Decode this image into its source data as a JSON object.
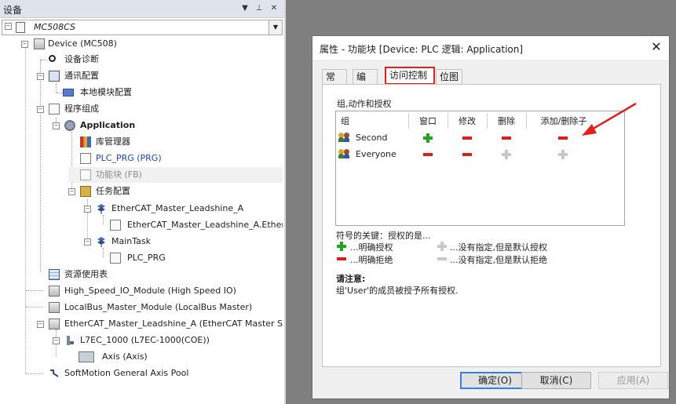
{
  "panel": {
    "title": "设备",
    "pin_glyph": "▼ ⊥ ✕",
    "project": "MC508CS",
    "tree": [
      {
        "label": "Device (MC508)"
      },
      {
        "label": "设备诊断"
      },
      {
        "label": "通讯配置"
      },
      {
        "label": "本地模块配置"
      },
      {
        "label": "程序组成"
      },
      {
        "label": "Application"
      },
      {
        "label": "库管理器"
      },
      {
        "label": "PLC_PRG (PRG)"
      },
      {
        "label": "功能块 (FB)"
      },
      {
        "label": "任务配置"
      },
      {
        "label": "EtherCAT_Master_Leadshine_A"
      },
      {
        "label": "EtherCAT_Master_Leadshine_A.EtherCAT_Task"
      },
      {
        "label": "MainTask"
      },
      {
        "label": "PLC_PRG"
      },
      {
        "label": "资源使用表"
      },
      {
        "label": "High_Speed_IO_Module (High Speed IO)"
      },
      {
        "label": "LocalBus_Master_Module (LocalBus Master)"
      },
      {
        "label": "EtherCAT_Master_Leadshine_A (EtherCAT Master SoftMotion)"
      },
      {
        "label": "L7EC_1000 (L7EC-1000(COE))"
      },
      {
        "label": "Axis (Axis)"
      },
      {
        "label": "SoftMotion General Axis Pool"
      }
    ]
  },
  "dialog": {
    "title": "属性 - 功能块 [Device: PLC 逻辑: Application]",
    "close": "✕",
    "tabs": [
      "常规",
      "编译",
      "访问控制",
      "位图"
    ],
    "active_tab": "访问控制",
    "group_label": "组,动作和授权",
    "columns": [
      "组",
      "窗口",
      "修改",
      "删除",
      "添加/删除子"
    ],
    "rows": [
      {
        "name": "Second",
        "perms": [
          "granted",
          "denied",
          "denied",
          "denied"
        ]
      },
      {
        "name": "Everyone",
        "perms": [
          "denied",
          "denied",
          "default-granted",
          "default-granted"
        ]
      }
    ],
    "legend_title": "符号的关键：授权的是...",
    "legend": {
      "granted": "...明确授权",
      "denied": "...明确拒绝",
      "default_granted": "...没有指定,但是默认授权",
      "default_denied": "...没有指定,但是默认拒绝"
    },
    "note_title": "请注意:",
    "note_text": "组'User'的成员被授予所有授权.",
    "buttons": {
      "ok": "确定(O)",
      "cancel": "取消(C)",
      "apply": "应用(A)"
    }
  },
  "colors": {
    "granted": "#22a323",
    "denied": "#d81e1e",
    "default": "#c8c8c8",
    "highlight": "#e0201c"
  }
}
